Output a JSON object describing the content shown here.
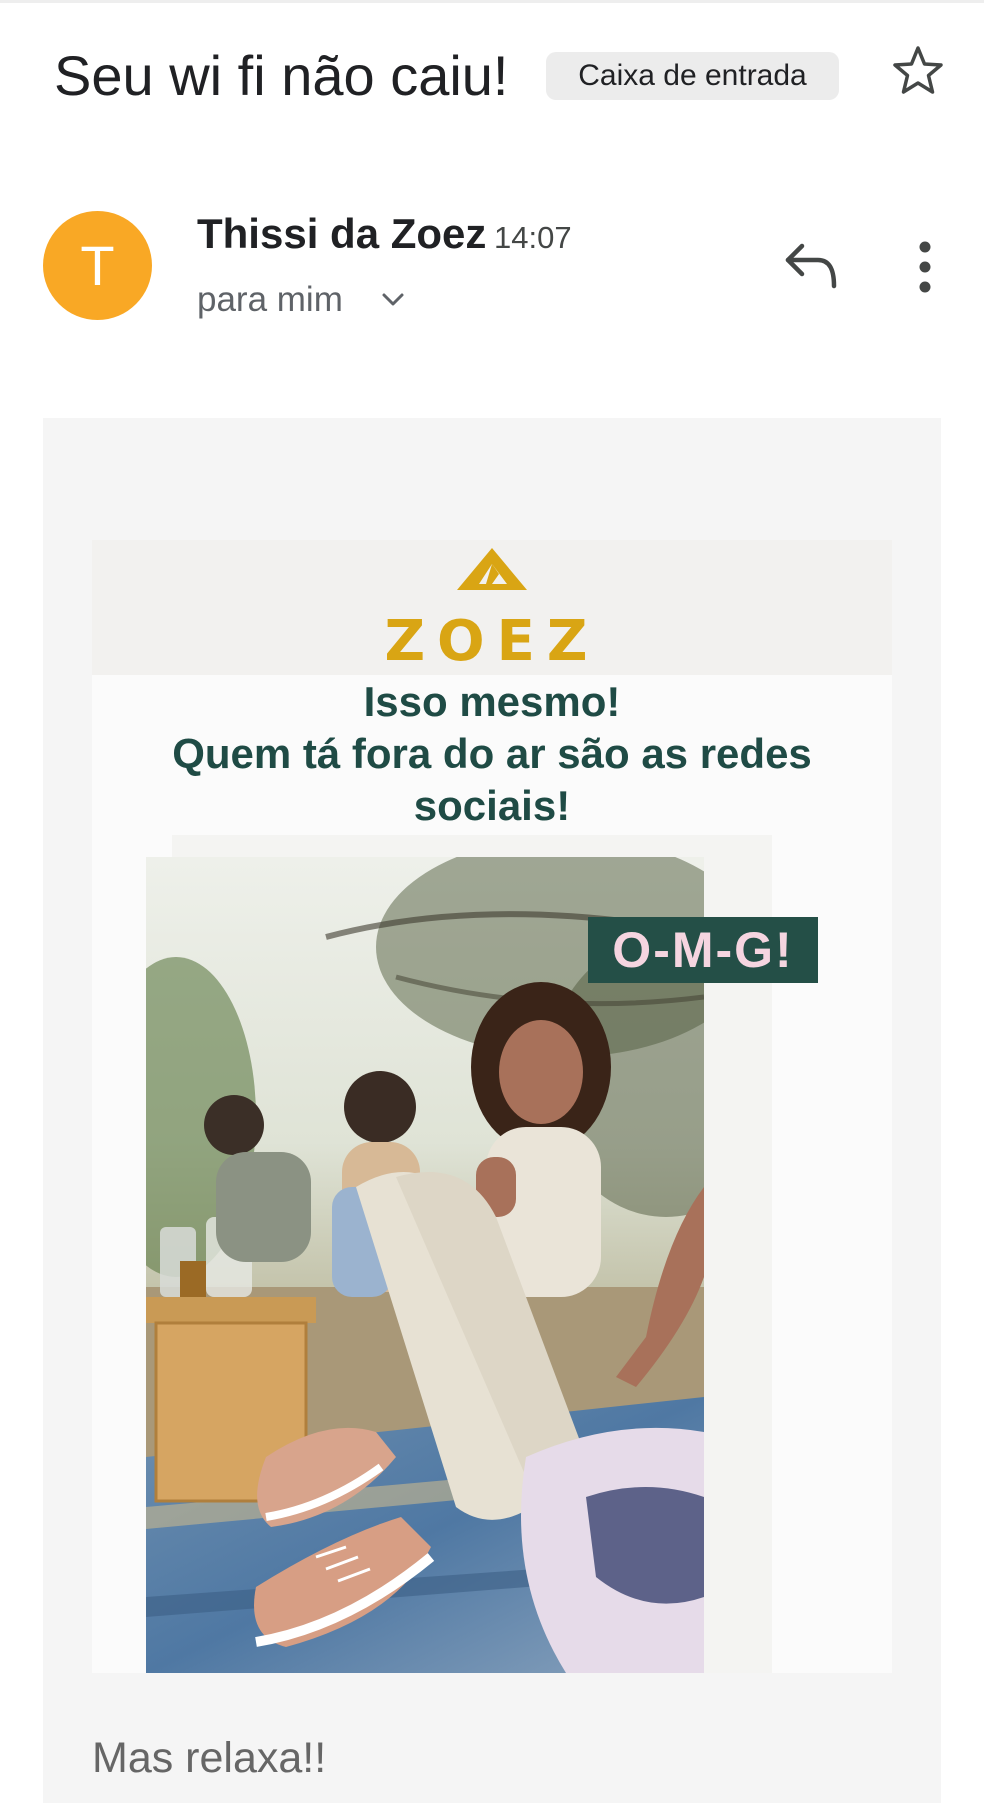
{
  "email": {
    "subject": "Seu wi fi não caiu!",
    "label": "Caixa de entrada",
    "sender": {
      "name": "Thissi da Zoez",
      "initial": "T",
      "avatar_color": "#f9a825",
      "time": "14:07",
      "recipient": "para mim"
    },
    "icons": {
      "star": "star-icon",
      "expand": "chevron-down-icon",
      "reply": "reply-icon",
      "more": "more-vert-icon"
    }
  },
  "content": {
    "brand": "ZOEZ",
    "brand_color": "#d9a514",
    "headline_lines": [
      "Isso mesmo!",
      "Quem tá fora do ar são as redes",
      "sociais!"
    ],
    "headline_color": "#1f4b45",
    "omg_label": "O-M-G!",
    "omg_bg": "#244f47",
    "footer_text": "Mas relaxa!!"
  }
}
